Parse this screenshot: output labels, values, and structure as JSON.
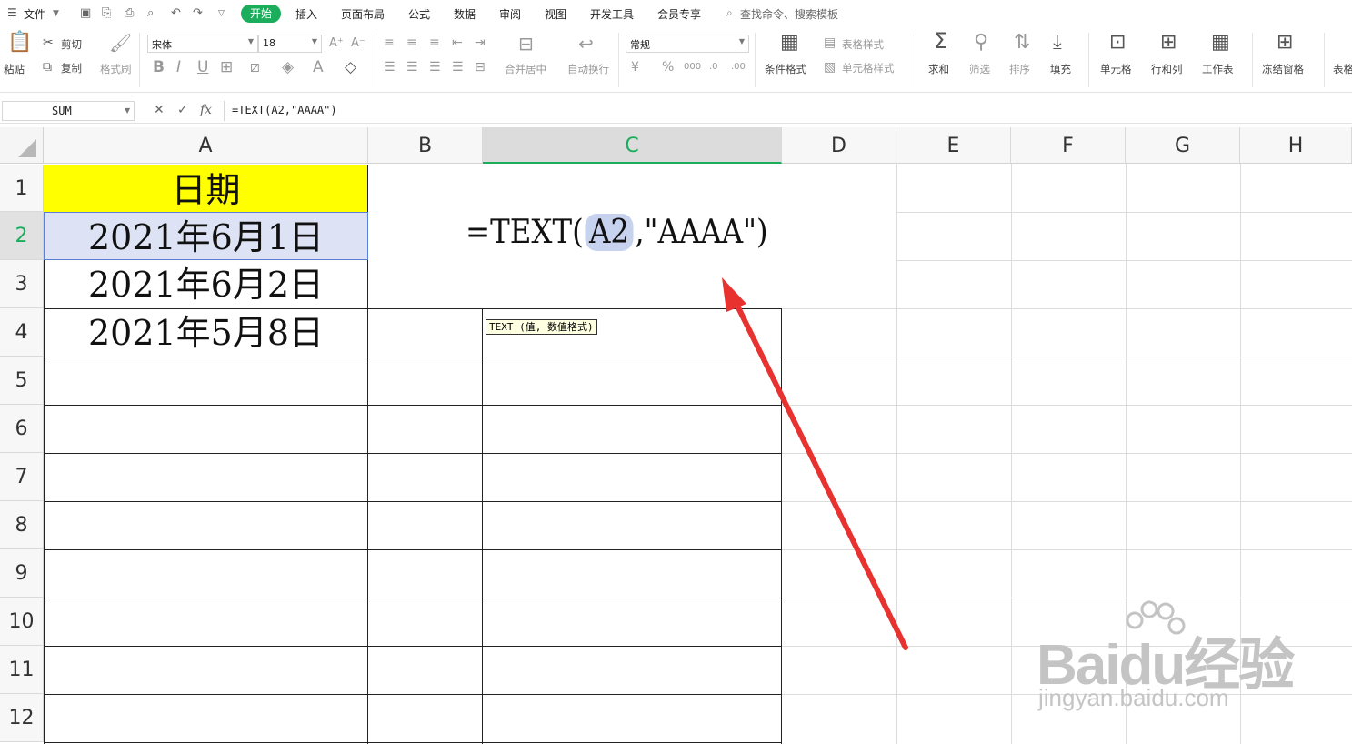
{
  "menubar": {
    "file": "文件",
    "tabs": [
      "开始",
      "插入",
      "页面布局",
      "公式",
      "数据",
      "审阅",
      "视图",
      "开发工具",
      "会员专享"
    ],
    "search": "查找命令、搜索模板"
  },
  "ribbon": {
    "paste": "粘贴",
    "cut": "剪切",
    "copy": "复制",
    "format_painter": "格式刷",
    "font_name": "宋体",
    "font_size": "18",
    "merge_center": "合并居中",
    "wrap_text": "自动换行",
    "number_format": "常规",
    "conditional_format": "条件格式",
    "table_style": "表格样式",
    "cell_style": "单元格样式",
    "sum": "求和",
    "filter": "筛选",
    "sort": "排序",
    "fill": "填充",
    "cells": "单元格",
    "rows_cols": "行和列",
    "worksheet": "工作表",
    "freeze": "冻结窗格",
    "table_tools": "表格"
  },
  "formula_bar": {
    "name_box": "SUM",
    "fx": "fx",
    "formula": "=TEXT(A2,\"AAAA\")"
  },
  "sheet": {
    "columns": [
      "A",
      "B",
      "C",
      "D",
      "E",
      "F",
      "G",
      "H"
    ],
    "rows": [
      "1",
      "2",
      "3",
      "4",
      "5",
      "6",
      "7",
      "8",
      "9",
      "10",
      "11",
      "12"
    ],
    "cells": {
      "A1": "日期",
      "A2": "2021年6月1日",
      "A3": "2021年6月2日",
      "A4": "2021年5月8日"
    },
    "editing": {
      "prefix": "=TEXT(",
      "ref": "A2",
      "suffix": ",\"AAAA\")"
    },
    "tooltip": "TEXT (值, 数值格式)"
  },
  "watermark": {
    "logo": "Baidu经验",
    "site": "jingyan.baidu.com"
  },
  "colors": {
    "accent": "#1aad5c",
    "header_fill": "#ffff00",
    "arrow": "#e8322f",
    "selection": "#dde3f4"
  }
}
